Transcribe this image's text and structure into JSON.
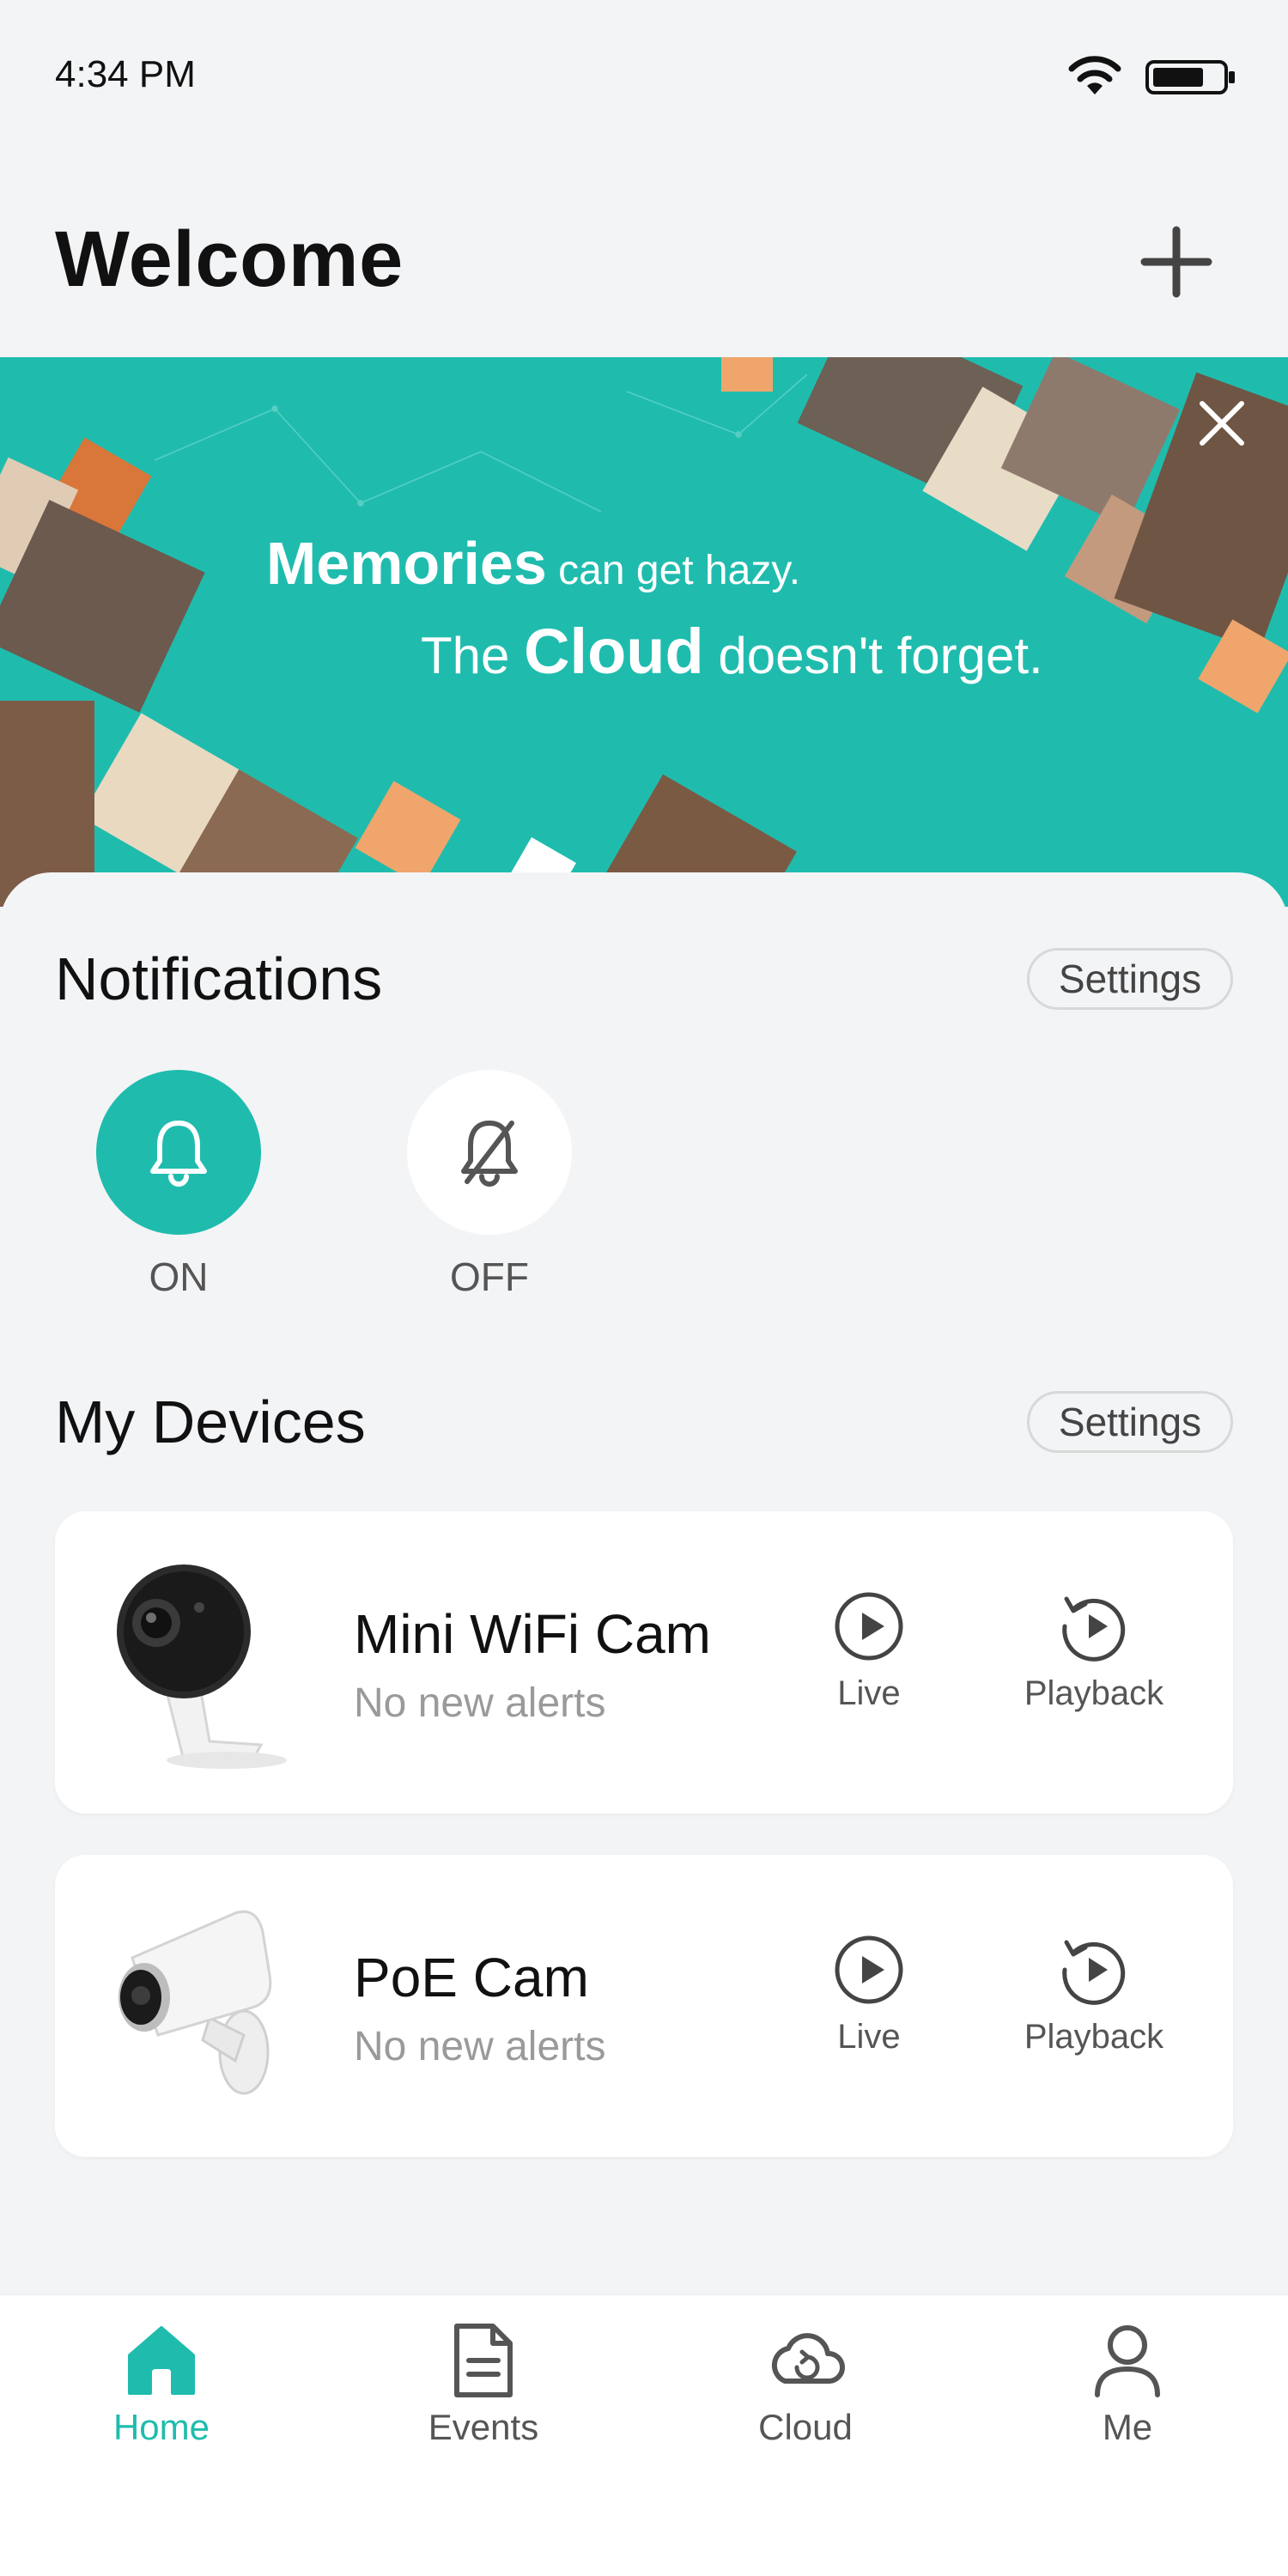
{
  "status_bar": {
    "time": "4:34 PM"
  },
  "header": {
    "title": "Welcome"
  },
  "banner": {
    "line1_bold": "Memories",
    "line1_rest": "can get hazy.",
    "line2_pre": "The",
    "line2_bold": "Cloud",
    "line2_rest": "doesn't forget."
  },
  "notifications": {
    "title": "Notifications",
    "settings_label": "Settings",
    "options": [
      {
        "label": "ON",
        "icon": "bell-icon",
        "selected": true
      },
      {
        "label": "OFF",
        "icon": "bell-off-icon",
        "selected": false
      }
    ]
  },
  "devices": {
    "title": "My Devices",
    "settings_label": "Settings",
    "items": [
      {
        "name": "Mini WiFi Cam",
        "status": "No new alerts",
        "live_label": "Live",
        "playback_label": "Playback",
        "image": "mini-wifi-camera-image"
      },
      {
        "name": "PoE Cam",
        "status": "No new alerts",
        "live_label": "Live",
        "playback_label": "Playback",
        "image": "poe-bullet-camera-image"
      }
    ]
  },
  "nav": {
    "items": [
      {
        "label": "Home",
        "icon": "home-icon",
        "active": true
      },
      {
        "label": "Events",
        "icon": "document-icon",
        "active": false
      },
      {
        "label": "Cloud",
        "icon": "cloud-icon",
        "active": false
      },
      {
        "label": "Me",
        "icon": "person-icon",
        "active": false
      }
    ]
  },
  "colors": {
    "accent": "#1fbcae",
    "banner_bg": "#1fbcae",
    "background": "#f3f4f6",
    "tile_orange": "#f0a56c",
    "tile_beige": "#e9dcc7"
  }
}
